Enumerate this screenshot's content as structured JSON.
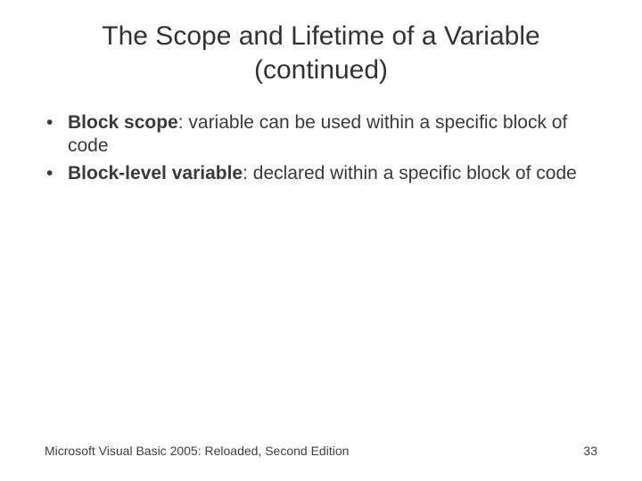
{
  "title": "The Scope and Lifetime of a Variable (continued)",
  "bullets": [
    {
      "term": "Block scope",
      "definition": ": variable can be used within a specific block of code"
    },
    {
      "term": "Block-level variable",
      "definition": ": declared within a specific block of code"
    }
  ],
  "footer": {
    "left": "Microsoft Visual Basic 2005: Reloaded, Second Edition",
    "page": "33"
  },
  "glyphs": {
    "bullet": "•"
  }
}
